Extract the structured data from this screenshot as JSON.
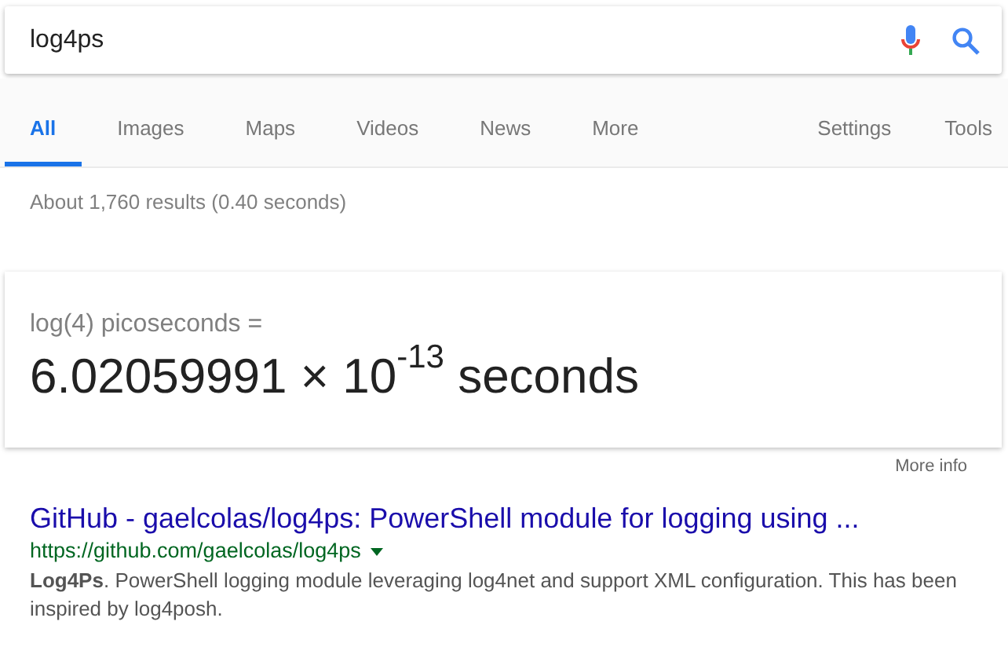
{
  "search": {
    "value": "log4ps"
  },
  "tabs": [
    {
      "label": "All",
      "selected": true
    },
    {
      "label": "Images",
      "selected": false
    },
    {
      "label": "Maps",
      "selected": false
    },
    {
      "label": "Videos",
      "selected": false
    },
    {
      "label": "News",
      "selected": false
    },
    {
      "label": "More",
      "selected": false
    }
  ],
  "options": [
    "Settings",
    "Tools"
  ],
  "result_stats": "About 1,760 results (0.40 seconds)",
  "answer": {
    "query": "log(4) picoseconds =",
    "value": "6.02059991 × 10$^{-13}$ seconds",
    "more_info": "More info"
  },
  "results": [
    {
      "title": "GitHub - gaelcolas/log4ps: PowerShell module for logging using ...",
      "url": "https://github.com/gaelcolas/log4ps",
      "snippet": "**Log4Ps**. PowerShell logging module leveraging log4net and support XML configuration. This has been inspired by log4posh."
    }
  ]
}
